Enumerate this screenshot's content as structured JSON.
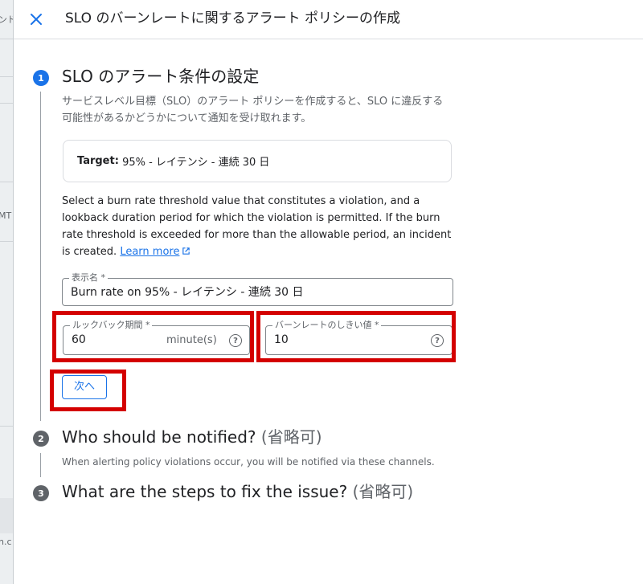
{
  "background": {
    "fragments": [
      "ンド",
      "MT",
      "n.c"
    ]
  },
  "header": {
    "close_icon": "close-icon",
    "title": "SLO のバーンレートに関するアラート ポリシーの作成"
  },
  "steps": [
    {
      "number": "1",
      "title": "SLO のアラート条件の設定",
      "description": "サービスレベル目標（SLO）のアラート ポリシーを作成すると、SLO に違反する可能性があるかどうかについて通知を受け取れます。"
    },
    {
      "number": "2",
      "title": "Who should be notified?",
      "optional": "(省略可)",
      "description": "When alerting policy violations occur, you will be notified via these channels."
    },
    {
      "number": "3",
      "title": "What are the steps to fix the issue?",
      "optional": "(省略可)"
    }
  ],
  "target_card": {
    "label": "Target:",
    "value": "95% - レイテンシ - 連続 30 日"
  },
  "info": {
    "text": "Select a burn rate threshold value that constitutes a violation, and a lookback duration period for which the violation is permitted. If the burn rate threshold is exceeded for more than the allowable period, an incident is created. ",
    "link": "Learn more",
    "link_icon": "external-link-icon"
  },
  "fields": {
    "display_name": {
      "label": "表示名 *",
      "value": "Burn rate on 95% - レイテンシ - 連続 30 日"
    },
    "lookback": {
      "label": "ルックバック期間 *",
      "value": "60",
      "suffix": "minute(s)",
      "help": "?"
    },
    "threshold": {
      "label": "バーンレートのしきい値 *",
      "value": "10",
      "help": "?"
    }
  },
  "next_button": {
    "label": "次へ"
  },
  "colors": {
    "accent": "#1a73e8",
    "highlight": "#d40000"
  }
}
